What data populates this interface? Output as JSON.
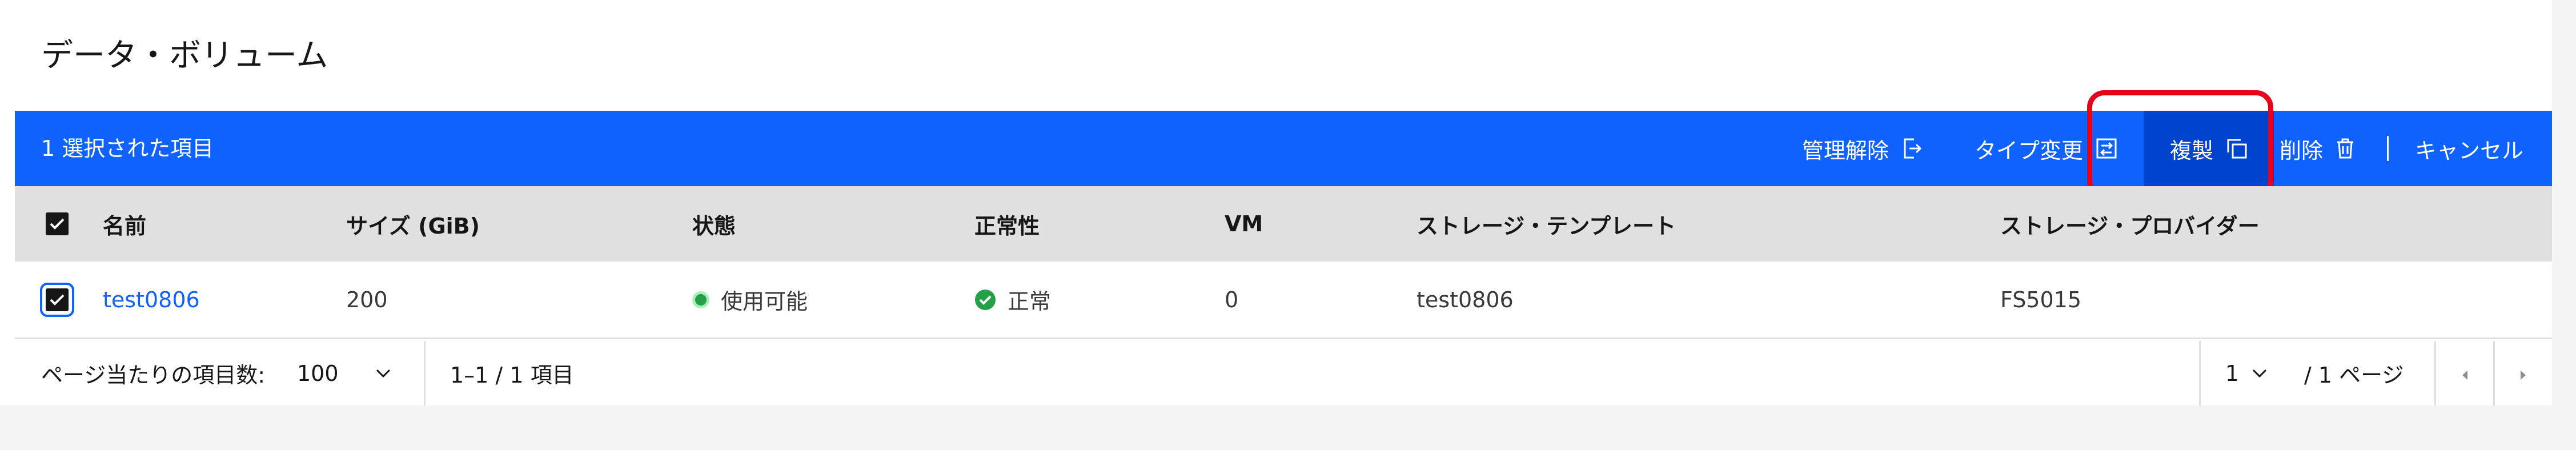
{
  "page": {
    "title": "データ・ボリューム"
  },
  "batch": {
    "count_text": "1 選択された項目",
    "actions": {
      "unmanage": "管理解除",
      "change_type": "タイプ変更",
      "duplicate": "複製",
      "delete": "削除",
      "cancel": "キャンセル"
    }
  },
  "table": {
    "headers": {
      "name": "名前",
      "size": "サイズ (GiB)",
      "state": "状態",
      "health": "正常性",
      "vm": "VM",
      "template": "ストレージ・テンプレート",
      "provider": "ストレージ・プロバイダー"
    },
    "rows": [
      {
        "name": "test0806",
        "size": "200",
        "state": "使用可能",
        "health": "正常",
        "vm": "0",
        "template": "test0806",
        "provider": "FS5015"
      }
    ]
  },
  "pagination": {
    "items_per_page_label": "ページ当たりの項目数:",
    "items_per_page": "100",
    "range_text": "1–1 / 1 項目",
    "page_value": "1",
    "page_total_text": "/ 1 ページ"
  },
  "colors": {
    "batch_bar": "#0f62fe",
    "active_button": "#0043ce",
    "highlight": "#e8001c",
    "status_green": "#24a148",
    "link": "#0f62fe"
  }
}
